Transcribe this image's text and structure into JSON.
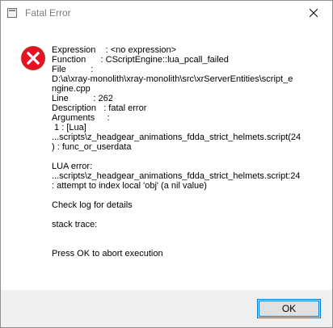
{
  "window": {
    "title": "Fatal Error",
    "app_icon": "app-window-icon",
    "close_icon": "close-icon"
  },
  "dialog": {
    "icon": "error-icon",
    "icon_color": "#e81123",
    "expression_line": "Expression    : <no expression>",
    "function_line": "Function      : CScriptEngine::lua_pcall_failed",
    "file_line": "File          :",
    "file_path_1": "D:\\a\\xray-monolith\\xray-monolith\\src\\xrServerEntities\\script_e",
    "file_path_2": "ngine.cpp",
    "line_line": "Line          : 262",
    "description_line": "Description   : fatal error",
    "arguments_line": "Arguments     :",
    "arg_1": " 1 : [Lua]",
    "arg_2": "...scripts\\z_headgear_animations_fdda_strict_helmets.script(24",
    "arg_3": ") : func_or_userdata",
    "lua_error_label": "LUA error:",
    "lua_error_1": "...scripts\\z_headgear_animations_fdda_strict_helmets.script:24",
    "lua_error_2": ": attempt to index local 'obj' (a nil value)",
    "check_log": "Check log for details",
    "stack_trace": "stack trace:",
    "press_ok": "Press OK to abort execution"
  },
  "footer": {
    "ok_label": "OK",
    "accent": "#0078d7"
  }
}
